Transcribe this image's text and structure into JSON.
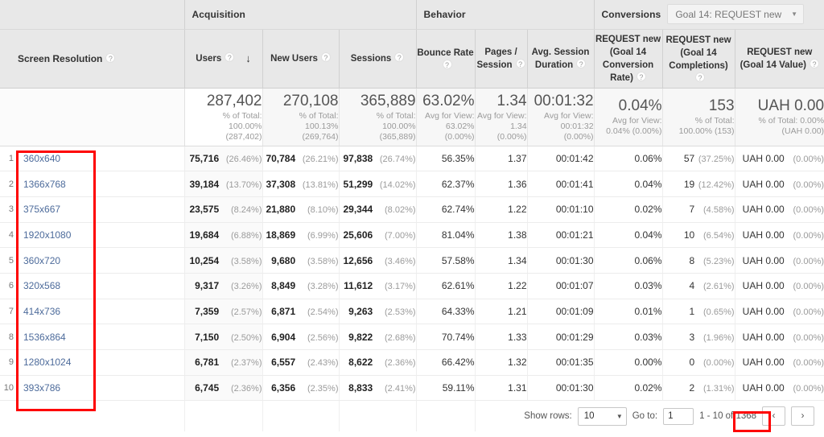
{
  "groups": {
    "dimension": "Screen Resolution",
    "acquisition": "Acquisition",
    "behavior": "Behavior",
    "conversions": "Conversions",
    "goal_selected": "Goal 14: REQUEST new"
  },
  "columns": [
    {
      "label": "Users",
      "help": "?",
      "sorted": true,
      "sort_dir": "desc"
    },
    {
      "label": "New Users",
      "help": "?",
      "sorted": false
    },
    {
      "label": "Sessions",
      "help": "?",
      "sorted": false
    },
    {
      "label": "Bounce Rate",
      "help": "?",
      "sorted": false
    },
    {
      "label": "Pages / Session",
      "help": "?",
      "sorted": false
    },
    {
      "label": "Avg. Session Duration",
      "help": "?",
      "sorted": false
    },
    {
      "label": "REQUEST new (Goal 14 Conversion Rate)",
      "help": "?",
      "sorted": false
    },
    {
      "label": "REQUEST new (Goal 14 Completions)",
      "help": "?",
      "sorted": false
    },
    {
      "label": "REQUEST new (Goal 14 Value)",
      "help": "?",
      "sorted": false
    }
  ],
  "summary": [
    {
      "big": "287,402",
      "sub": "% of Total:\n100.00%\n(287,402)"
    },
    {
      "big": "270,108",
      "sub": "% of Total:\n100.13%\n(269,764)"
    },
    {
      "big": "365,889",
      "sub": "% of Total:\n100.00%\n(365,889)"
    },
    {
      "big": "63.02%",
      "sub": "Avg for View:\n63.02%\n(0.00%)"
    },
    {
      "big": "1.34",
      "sub": "Avg for View:\n1.34\n(0.00%)"
    },
    {
      "big": "00:01:32",
      "sub": "Avg for View:\n00:01:32\n(0.00%)"
    },
    {
      "big": "0.04%",
      "sub": "Avg for View:\n0.04% (0.00%)"
    },
    {
      "big": "153",
      "sub": "% of Total:\n100.00% (153)"
    },
    {
      "big": "UAH 0.00",
      "sub": "% of Total: 0.00%\n(UAH 0.00)"
    }
  ],
  "rows": [
    {
      "index": "1",
      "dimension": "360x640",
      "users": "75,716",
      "users_pct": "(26.46%)",
      "new_users": "70,784",
      "new_users_pct": "(26.21%)",
      "sessions": "97,838",
      "sessions_pct": "(26.74%)",
      "bounce": "56.35%",
      "pages": "1.37",
      "duration": "00:01:42",
      "conv_rate": "0.06%",
      "completions": "57",
      "completions_pct": "(37.25%)",
      "value": "UAH 0.00",
      "value_pct": "(0.00%)"
    },
    {
      "index": "2",
      "dimension": "1366x768",
      "users": "39,184",
      "users_pct": "(13.70%)",
      "new_users": "37,308",
      "new_users_pct": "(13.81%)",
      "sessions": "51,299",
      "sessions_pct": "(14.02%)",
      "bounce": "62.37%",
      "pages": "1.36",
      "duration": "00:01:41",
      "conv_rate": "0.04%",
      "completions": "19",
      "completions_pct": "(12.42%)",
      "value": "UAH 0.00",
      "value_pct": "(0.00%)"
    },
    {
      "index": "3",
      "dimension": "375x667",
      "users": "23,575",
      "users_pct": "(8.24%)",
      "new_users": "21,880",
      "new_users_pct": "(8.10%)",
      "sessions": "29,344",
      "sessions_pct": "(8.02%)",
      "bounce": "62.74%",
      "pages": "1.22",
      "duration": "00:01:10",
      "conv_rate": "0.02%",
      "completions": "7",
      "completions_pct": "(4.58%)",
      "value": "UAH 0.00",
      "value_pct": "(0.00%)"
    },
    {
      "index": "4",
      "dimension": "1920x1080",
      "users": "19,684",
      "users_pct": "(6.88%)",
      "new_users": "18,869",
      "new_users_pct": "(6.99%)",
      "sessions": "25,606",
      "sessions_pct": "(7.00%)",
      "bounce": "81.04%",
      "pages": "1.38",
      "duration": "00:01:21",
      "conv_rate": "0.04%",
      "completions": "10",
      "completions_pct": "(6.54%)",
      "value": "UAH 0.00",
      "value_pct": "(0.00%)"
    },
    {
      "index": "5",
      "dimension": "360x720",
      "users": "10,254",
      "users_pct": "(3.58%)",
      "new_users": "9,680",
      "new_users_pct": "(3.58%)",
      "sessions": "12,656",
      "sessions_pct": "(3.46%)",
      "bounce": "57.58%",
      "pages": "1.34",
      "duration": "00:01:30",
      "conv_rate": "0.06%",
      "completions": "8",
      "completions_pct": "(5.23%)",
      "value": "UAH 0.00",
      "value_pct": "(0.00%)"
    },
    {
      "index": "6",
      "dimension": "320x568",
      "users": "9,317",
      "users_pct": "(3.26%)",
      "new_users": "8,849",
      "new_users_pct": "(3.28%)",
      "sessions": "11,612",
      "sessions_pct": "(3.17%)",
      "bounce": "62.61%",
      "pages": "1.22",
      "duration": "00:01:07",
      "conv_rate": "0.03%",
      "completions": "4",
      "completions_pct": "(2.61%)",
      "value": "UAH 0.00",
      "value_pct": "(0.00%)"
    },
    {
      "index": "7",
      "dimension": "414x736",
      "users": "7,359",
      "users_pct": "(2.57%)",
      "new_users": "6,871",
      "new_users_pct": "(2.54%)",
      "sessions": "9,263",
      "sessions_pct": "(2.53%)",
      "bounce": "64.33%",
      "pages": "1.21",
      "duration": "00:01:09",
      "conv_rate": "0.01%",
      "completions": "1",
      "completions_pct": "(0.65%)",
      "value": "UAH 0.00",
      "value_pct": "(0.00%)"
    },
    {
      "index": "8",
      "dimension": "1536x864",
      "users": "7,150",
      "users_pct": "(2.50%)",
      "new_users": "6,904",
      "new_users_pct": "(2.56%)",
      "sessions": "9,822",
      "sessions_pct": "(2.68%)",
      "bounce": "70.74%",
      "pages": "1.33",
      "duration": "00:01:29",
      "conv_rate": "0.03%",
      "completions": "3",
      "completions_pct": "(1.96%)",
      "value": "UAH 0.00",
      "value_pct": "(0.00%)"
    },
    {
      "index": "9",
      "dimension": "1280x1024",
      "users": "6,781",
      "users_pct": "(2.37%)",
      "new_users": "6,557",
      "new_users_pct": "(2.43%)",
      "sessions": "8,622",
      "sessions_pct": "(2.36%)",
      "bounce": "66.42%",
      "pages": "1.32",
      "duration": "00:01:35",
      "conv_rate": "0.00%",
      "completions": "0",
      "completions_pct": "(0.00%)",
      "value": "UAH 0.00",
      "value_pct": "(0.00%)"
    },
    {
      "index": "10",
      "dimension": "393x786",
      "users": "6,745",
      "users_pct": "(2.36%)",
      "new_users": "6,356",
      "new_users_pct": "(2.35%)",
      "sessions": "8,833",
      "sessions_pct": "(2.41%)",
      "bounce": "59.11%",
      "pages": "1.31",
      "duration": "00:01:30",
      "conv_rate": "0.02%",
      "completions": "2",
      "completions_pct": "(1.31%)",
      "value": "UAH 0.00",
      "value_pct": "(0.00%)"
    }
  ],
  "footer": {
    "show_rows_label": "Show rows:",
    "show_rows_value": "10",
    "goto_label": "Go to:",
    "goto_value": "1",
    "range_text": "1 - 10 of 1368",
    "prev_icon": "‹",
    "next_icon": "›"
  },
  "annotations": {
    "highlight_color": "#fe0000",
    "dimension_box": "screen resolution values highlighted",
    "total_box": "of 1368 highlighted"
  }
}
